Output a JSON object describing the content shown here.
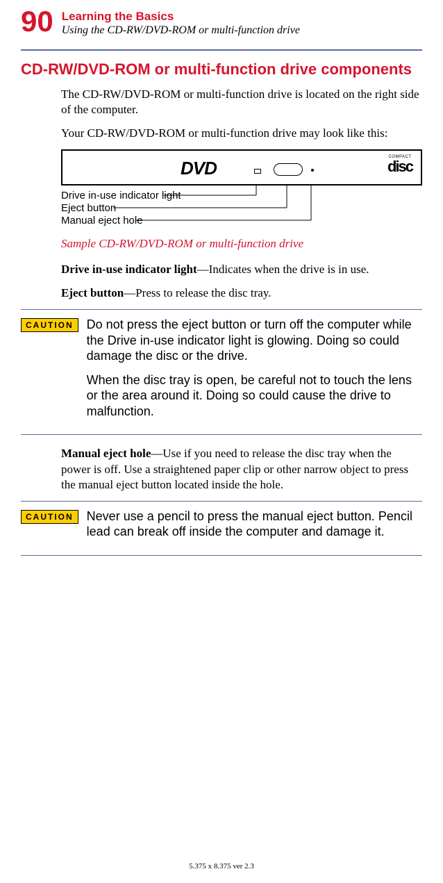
{
  "header": {
    "page_number": "90",
    "chapter_title": "Learning the Basics",
    "section_title": "Using the CD-RW/DVD-ROM or multi-function drive"
  },
  "heading": "CD-RW/DVD-ROM or multi-function drive components",
  "intro_para1": "The CD-RW/DVD-ROM or multi-function drive is located on the right side of the computer.",
  "intro_para2": "Your CD-RW/DVD-ROM or multi-function drive may look like this:",
  "diagram": {
    "dvd_logo": "DVD",
    "compact_label": "COMPACT",
    "disc_label": "disc",
    "callout1": "Drive in-use indicator light",
    "callout2": "Eject button",
    "callout3": "Manual eject hole",
    "caption": "Sample CD-RW/DVD-ROM or multi-function drive"
  },
  "definitions": {
    "d1_term": "Drive in-use indicator light",
    "d1_desc": "—Indicates when the drive is in use.",
    "d2_term": "Eject button",
    "d2_desc": "—Press to release the disc tray.",
    "d3_term": "Manual eject hole",
    "d3_desc": "—Use if you need to release the disc tray when the power is off. Use a straightened paper clip or other narrow object to press the manual eject button located inside the hole."
  },
  "cautions": {
    "badge": "CAUTION",
    "c1p1": "Do not press the eject button or turn off the computer while the Drive in-use indicator light is glowing. Doing so could damage the disc or the drive.",
    "c1p2": "When the disc tray is open, be careful not to touch the lens or the area around it. Doing so could cause the drive to malfunction.",
    "c2p1": "Never use a pencil to press the manual eject button. Pencil lead can break off inside the computer and damage it."
  },
  "footer": "5.375 x 8.375 ver 2.3"
}
